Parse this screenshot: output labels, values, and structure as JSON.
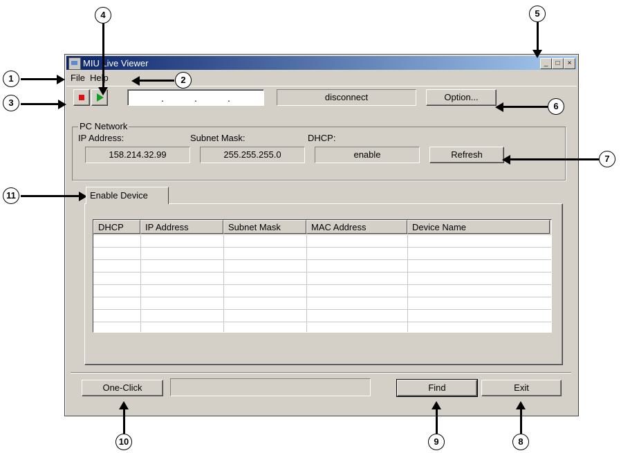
{
  "window": {
    "title": "MIU Live Viewer",
    "minimize": "_",
    "maximize": "□",
    "close": "×"
  },
  "menu": {
    "file": "File",
    "help": "Help"
  },
  "toolbar": {
    "ip_dots": [
      ".",
      ".",
      "."
    ],
    "status_text": "disconnect",
    "option_label": "Option..."
  },
  "pc_network": {
    "legend": "PC Network",
    "ip_label": "IP Address:",
    "ip_value": "158.214.32.99",
    "subnet_label": "Subnet Mask:",
    "subnet_value": "255.255.255.0",
    "dhcp_label": "DHCP:",
    "dhcp_value": "enable",
    "refresh_label": "Refresh"
  },
  "tab": {
    "label": "Enable Device"
  },
  "table": {
    "columns": [
      "DHCP",
      "IP Address",
      "Subnet Mask",
      "MAC Address",
      "Device Name"
    ],
    "rows": []
  },
  "footer": {
    "one_click": "One-Click",
    "find": "Find",
    "exit": "Exit"
  },
  "callouts": {
    "c1": "1",
    "c2": "2",
    "c3": "3",
    "c4": "4",
    "c5": "5",
    "c6": "6",
    "c7": "7",
    "c8": "8",
    "c9": "9",
    "c10": "10",
    "c11": "11"
  },
  "colors": {
    "title_gradient_start": "#0a246a",
    "title_gradient_end": "#a6caf0",
    "window_bg": "#d4d0c8",
    "stop_icon": "#e01010",
    "play_icon": "#10a020"
  }
}
